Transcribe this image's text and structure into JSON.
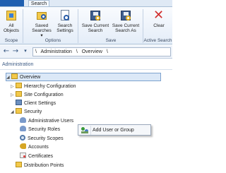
{
  "ribbon": {
    "active_tab": "Search",
    "buttons": {
      "all_objects": "All\nObjects",
      "saved_searches": "Saved\nSearches ▾",
      "search_settings": "Search\nSettings",
      "save_current_search": "Save Current\nSearch",
      "save_current_search_as": "Save Current\nSearch As",
      "clear": "Clear"
    },
    "groups": {
      "scope": "Scope",
      "options": "Options",
      "save": "Save",
      "active_search": "Active Search"
    }
  },
  "address_bar": {
    "separator": "\\",
    "crumbs": [
      "Administration",
      "Overview"
    ]
  },
  "nav_pane": {
    "title": "Administration",
    "tree": [
      {
        "label": "Overview",
        "expander": "◢"
      },
      {
        "label": "Hierarchy Configuration",
        "expander": "▷"
      },
      {
        "label": "Site Configuration",
        "expander": "▷"
      },
      {
        "label": "Client Settings",
        "expander": ""
      },
      {
        "label": "Security",
        "expander": "◢"
      },
      {
        "label": "Administrative Users",
        "expander": ""
      },
      {
        "label": "Security Roles",
        "expander": ""
      },
      {
        "label": "Security Scopes",
        "expander": ""
      },
      {
        "label": "Accounts",
        "expander": ""
      },
      {
        "label": "Certificates",
        "expander": ""
      },
      {
        "label": "Distribution Points",
        "expander": ""
      }
    ]
  },
  "context_menu": {
    "items": [
      "Add User or Group"
    ]
  },
  "colors": {
    "accent": "#1f5fb0",
    "selection": "#dbe8f7",
    "folder": "#f3c94a"
  }
}
